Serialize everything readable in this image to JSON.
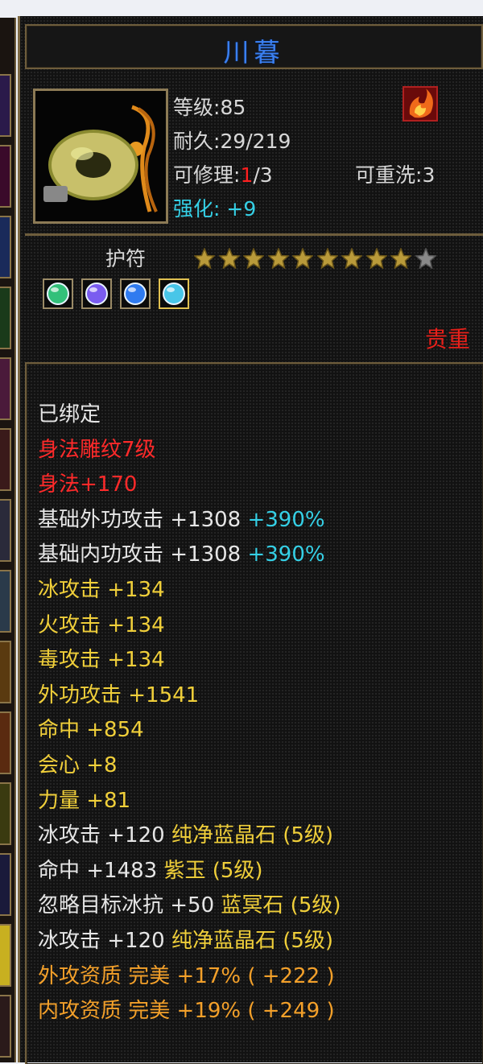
{
  "item": {
    "name": "川暮",
    "level_label": "等级:",
    "level": "85",
    "durability_label": "耐久:",
    "durability": "29/219",
    "repair_label": "可修理:",
    "repair_current": "1",
    "repair_max": "/3",
    "reroll_label": "可重洗:",
    "reroll": "3",
    "enhance_label": "强化:",
    "enhance": "+9",
    "type": "护符",
    "stars_filled": 9,
    "stars_total": 10,
    "rarity": "贵重",
    "icon": "jade-ring-pendant-icon",
    "badge_icon": "flame-badge-icon"
  },
  "gems": [
    {
      "icon": "green-gem-icon",
      "color": "#33c07a"
    },
    {
      "icon": "purple-gem-icon",
      "color": "#7a5cf0"
    },
    {
      "icon": "blue-gem-icon",
      "color": "#2f7bf0"
    },
    {
      "icon": "cyan-gem-icon",
      "color": "#48c6e8"
    }
  ],
  "attributes": [
    {
      "text": "已绑定",
      "color": "white"
    },
    {
      "text": "身法雕纹7级",
      "color": "red"
    },
    {
      "text": "身法+170",
      "color": "red"
    },
    {
      "text": "基础外功攻击 +1308 ",
      "extra": "+390%",
      "color": "white"
    },
    {
      "text": "基础内功攻击 +1308 ",
      "extra": "+390%",
      "color": "white"
    },
    {
      "text": "冰攻击 +134",
      "color": "yellow"
    },
    {
      "text": "火攻击 +134",
      "color": "yellow"
    },
    {
      "text": "毒攻击 +134",
      "color": "yellow"
    },
    {
      "text": "外功攻击 +1541",
      "color": "yellow"
    },
    {
      "text": "命中 +854",
      "color": "yellow"
    },
    {
      "text": "会心 +8",
      "color": "yellow"
    },
    {
      "text": "力量 +81",
      "color": "yellow"
    },
    {
      "text": "冰攻击 +120 ",
      "extra": "纯净蓝晶石 (5级)",
      "color": "white",
      "extra_color": "yellow"
    },
    {
      "text": "命中 +1483 ",
      "extra": "紫玉 (5级)",
      "color": "white",
      "extra_color": "yellow"
    },
    {
      "text": "忽略目标冰抗 +50 ",
      "extra": "蓝冥石 (5级)",
      "color": "white",
      "extra_color": "yellow"
    },
    {
      "text": "冰攻击 +120 ",
      "extra": "纯净蓝晶石 (5级)",
      "color": "white",
      "extra_color": "yellow"
    },
    {
      "text": "外攻资质  完美 +17% ( +222 )",
      "color": "orange"
    },
    {
      "text": "内攻资质  完美 +19% ( +249 )",
      "color": "orange"
    }
  ],
  "colors": {
    "title": "#3a7ff0",
    "red": "#ff2a2a",
    "yellow": "#f0cf3a",
    "orange": "#f3a02a",
    "cyan": "#35d0e6",
    "border": "#6e5d3c"
  }
}
